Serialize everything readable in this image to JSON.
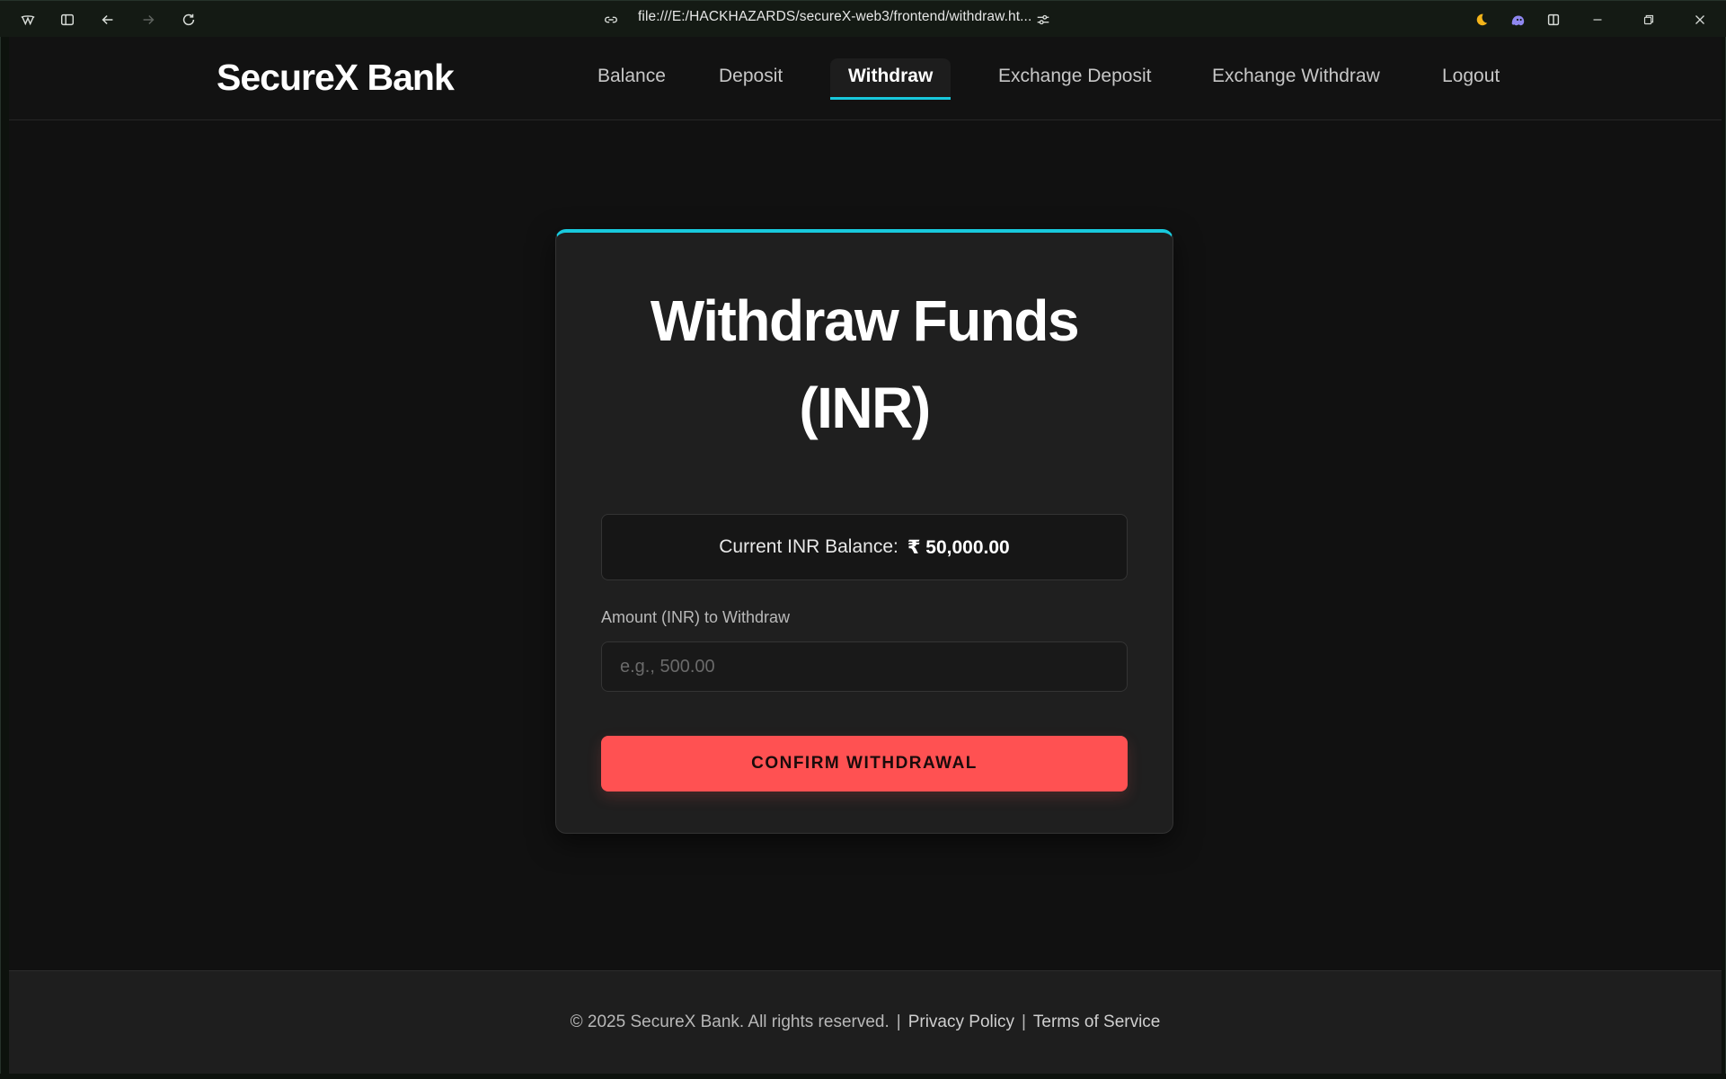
{
  "browser": {
    "url": "file:///E:/HACKHAZARDS/secureX-web3/frontend/withdraw.ht...",
    "icons": [
      "browser-logo-icon",
      "sidebar-toggle-icon",
      "back-arrow-icon",
      "forward-arrow-icon",
      "reload-icon",
      "link-icon",
      "page-settings-icon",
      "moon-icon",
      "ghost-extension-icon",
      "split-view-icon",
      "minimize-icon",
      "restore-icon",
      "close-icon"
    ]
  },
  "navbar": {
    "brand": "SecureX Bank",
    "links": [
      {
        "label": "Balance",
        "active": false
      },
      {
        "label": "Deposit",
        "active": false
      },
      {
        "label": "Withdraw",
        "active": true
      },
      {
        "label": "Exchange Deposit",
        "active": false
      },
      {
        "label": "Exchange Withdraw",
        "active": false
      },
      {
        "label": "Logout",
        "active": false
      }
    ]
  },
  "card": {
    "title_line1": "Withdraw Funds",
    "title_line2": "(INR)",
    "balance_label": "Current INR Balance:",
    "balance_value": "₹ 50,000.00",
    "amount_label": "Amount (INR) to Withdraw",
    "amount_value": "",
    "amount_placeholder": "e.g., 500.00",
    "confirm_label": "CONFIRM WITHDRAWAL"
  },
  "footer": {
    "copyright": "© 2025 SecureX Bank. All rights reserved.",
    "separator": "|",
    "privacy": "Privacy Policy",
    "terms": "Terms of Service"
  },
  "colors": {
    "accent": "#18c9dd",
    "danger_button": "#ff5152",
    "background": "#111111",
    "card": "#1f1f1f"
  }
}
